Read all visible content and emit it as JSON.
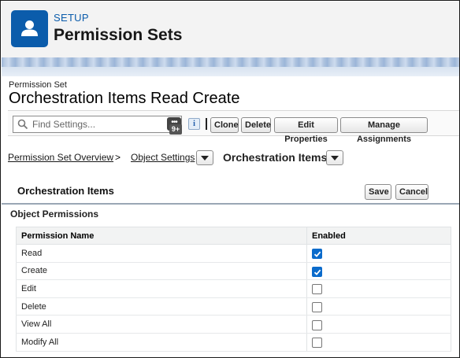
{
  "header": {
    "section": "SETUP",
    "title": "Permission Sets"
  },
  "permission_set": {
    "label": "Permission Set",
    "name": "Orchestration Items Read Create"
  },
  "toolbar": {
    "search_placeholder": "Find Settings...",
    "dots": "•••",
    "badge": "9+",
    "info": "i",
    "clone": "Clone",
    "delete": "Delete",
    "edit_properties": "Edit Properties",
    "manage_assignments": "Manage Assignments"
  },
  "breadcrumb": {
    "overview": "Permission Set Overview",
    "separator": ">",
    "object_settings": "Object Settings",
    "current": "Orchestration Items"
  },
  "section": {
    "title": "Orchestration Items",
    "save": "Save",
    "cancel": "Cancel"
  },
  "object_permissions": {
    "title": "Object Permissions",
    "columns": [
      "Permission Name",
      "Enabled"
    ],
    "rows": [
      {
        "name": "Read",
        "enabled": true
      },
      {
        "name": "Create",
        "enabled": true
      },
      {
        "name": "Edit",
        "enabled": false
      },
      {
        "name": "Delete",
        "enabled": false
      },
      {
        "name": "View All",
        "enabled": false
      },
      {
        "name": "Modify All",
        "enabled": false
      }
    ]
  },
  "colors": {
    "brand": "#0b5cab",
    "checkbox_on": "#0b6bcb"
  }
}
